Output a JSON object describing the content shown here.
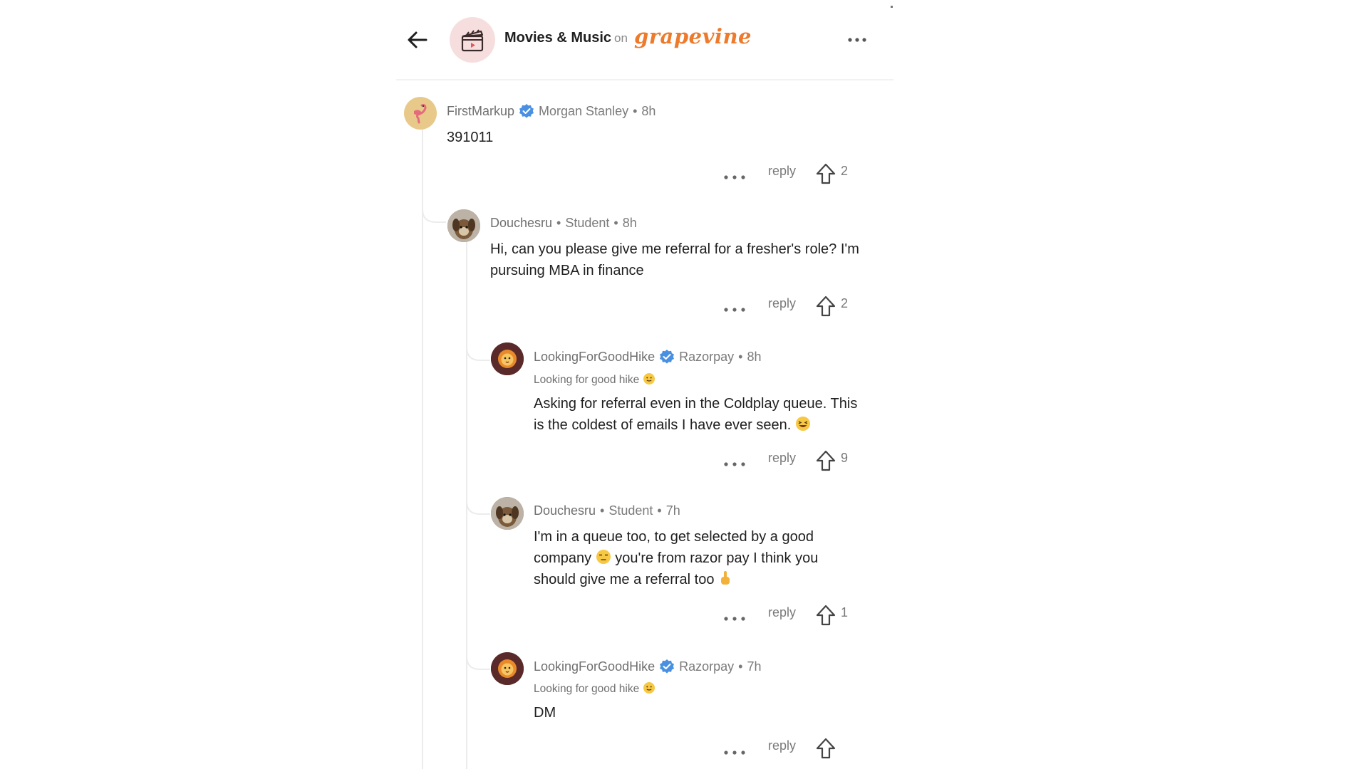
{
  "header": {
    "community": "Movies & Music",
    "on_label": "on",
    "brand": "grapevine",
    "icons": {
      "back": "arrow-left-icon",
      "community": "clapperboard-icon",
      "more": "more-horizontal-icon"
    }
  },
  "colors": {
    "brand": "#ee7a2c",
    "verified": "#4a90e2",
    "text": "#1f1f1f",
    "muted": "#7a7a7a"
  },
  "comments": [
    {
      "username": "FirstMarkup",
      "verified": true,
      "company": "Morgan Stanley",
      "time": "8h",
      "tagline": "",
      "text": "391011",
      "reply_label": "reply",
      "upvotes": "2",
      "avatar": "flamingo"
    },
    {
      "username": "Douchesru",
      "verified": false,
      "company": "Student",
      "time": "8h",
      "tagline": "",
      "text": "Hi, can you please give me referral for a fresher's role? I'm pursuing MBA in finance",
      "reply_label": "reply",
      "upvotes": "2",
      "avatar": "dog"
    },
    {
      "username": "LookingForGoodHike",
      "verified": true,
      "company": "Razorpay",
      "time": "8h",
      "tagline": "Looking for good hike",
      "text": "Asking for referral even in the Coldplay queue. This is the coldest of emails I have ever seen.",
      "reply_label": "reply",
      "upvotes": "9",
      "avatar": "lion"
    },
    {
      "username": "Douchesru",
      "verified": false,
      "company": "Student",
      "time": "7h",
      "tagline": "",
      "text": "I'm in a queue too, to get selected by a good company",
      "text_2": "you're from razor pay I think you should give me a referral too",
      "reply_label": "reply",
      "upvotes": "1",
      "avatar": "dog"
    },
    {
      "username": "LookingForGoodHike",
      "verified": true,
      "company": "Razorpay",
      "time": "7h",
      "tagline": "Looking for good hike",
      "text": "DM",
      "reply_label": "reply",
      "upvotes": "",
      "avatar": "lion"
    }
  ],
  "separator": "•"
}
